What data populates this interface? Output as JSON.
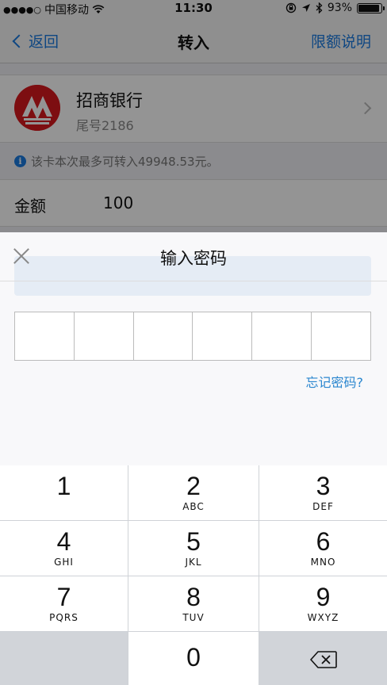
{
  "status_bar": {
    "signal_dots": "●●●●○",
    "carrier": "中国移动",
    "time": "11:30",
    "battery": "93%",
    "battery_level": 0.93
  },
  "nav": {
    "back_label": "返回",
    "title": "转入",
    "right_label": "限额说明"
  },
  "bank": {
    "name": "招商银行",
    "tail_number": "尾号2186"
  },
  "notice": {
    "icon": "i",
    "text": "该卡本次最多可转入49948.53元。"
  },
  "amount": {
    "label": "金额",
    "value": "100"
  },
  "password_sheet": {
    "title": "输入密码",
    "pin_length": 6,
    "forgot_label": "忘记密码?"
  },
  "keypad": {
    "keys": [
      {
        "num": "1",
        "letters": ""
      },
      {
        "num": "2",
        "letters": "ABC"
      },
      {
        "num": "3",
        "letters": "DEF"
      },
      {
        "num": "4",
        "letters": "GHI"
      },
      {
        "num": "5",
        "letters": "JKL"
      },
      {
        "num": "6",
        "letters": "MNO"
      },
      {
        "num": "7",
        "letters": "PQRS"
      },
      {
        "num": "8",
        "letters": "TUV"
      },
      {
        "num": "9",
        "letters": "WXYZ"
      },
      {
        "num": "0",
        "letters": ""
      }
    ]
  },
  "colors": {
    "accent": "#1a7ae0",
    "bank_red": "#d7191e",
    "link": "#2a86cf"
  }
}
